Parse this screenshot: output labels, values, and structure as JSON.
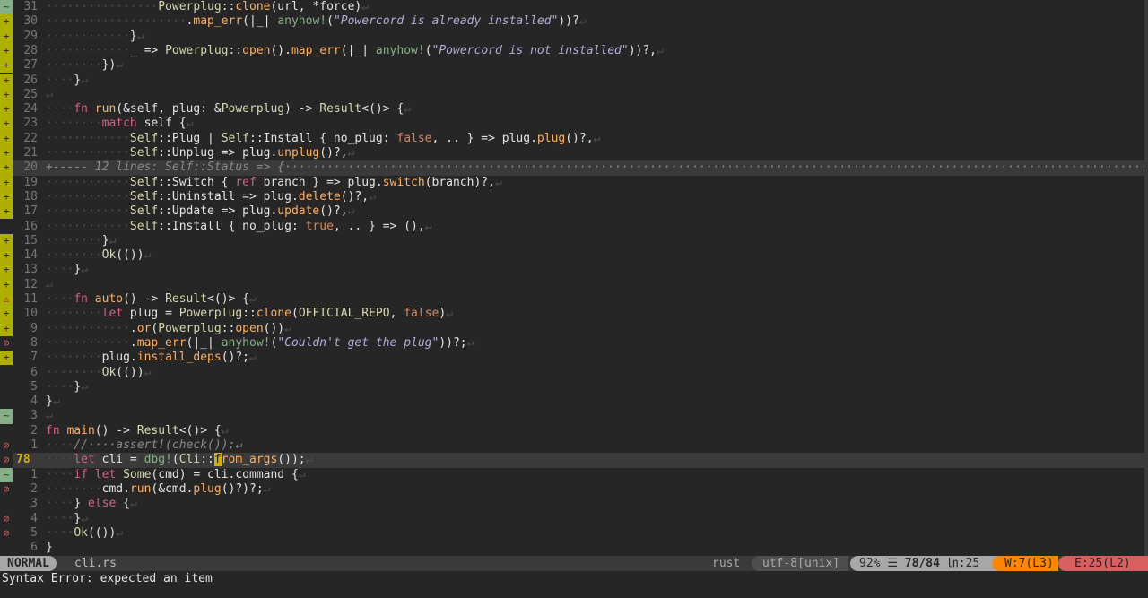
{
  "editor": {
    "lines": [
      {
        "sign": "chg",
        "num": "31",
        "text": "················Powerplug::clone(url, *force)↵"
      },
      {
        "sign": "add",
        "num": "30",
        "text": "····················.map_err(|_| anyhow!(\"Powercord is already installed\"))?↵"
      },
      {
        "sign": "add",
        "num": "29",
        "text": "············}↵"
      },
      {
        "sign": "add",
        "num": "28",
        "text": "············_ => Powerplug::open().map_err(|_| anyhow!(\"Powercord is not installed\"))?,↵"
      },
      {
        "sign": "add",
        "num": "27",
        "text": "········})↵"
      },
      {
        "sign": "add",
        "num": "26",
        "text": "····}↵"
      },
      {
        "sign": "add",
        "num": "25",
        "text": "↵"
      },
      {
        "sign": "add",
        "num": "24",
        "text": "····fn run(&self, plug: &Powerplug) -> Result<()> {↵"
      },
      {
        "sign": "add",
        "num": "23",
        "text": "········match self {↵"
      },
      {
        "sign": "add",
        "num": "22",
        "text": "············Self::Plug | Self::Install { no_plug: false, .. } => plug.plug()?,↵"
      },
      {
        "sign": "add",
        "num": "21",
        "text": "············Self::Unplug => plug.unplug()?,↵"
      },
      {
        "sign": "add",
        "num": "20",
        "text": "+----- 12 lines: Self::Status => {··········································································································································",
        "fold": true
      },
      {
        "sign": "add",
        "num": "19",
        "text": "············Self::Switch { ref branch } => plug.switch(branch)?,↵"
      },
      {
        "sign": "add",
        "num": "18",
        "text": "············Self::Uninstall => plug.delete()?,↵"
      },
      {
        "sign": "add",
        "num": "17",
        "text": "············Self::Update => plug.update()?,↵"
      },
      {
        "sign": "none",
        "num": "16",
        "text": "············Self::Install { no_plug: true, .. } => (),↵"
      },
      {
        "sign": "add",
        "num": "15",
        "text": "········}↵"
      },
      {
        "sign": "add",
        "num": "14",
        "text": "········Ok(())↵"
      },
      {
        "sign": "add",
        "num": "13",
        "text": "····}↵"
      },
      {
        "sign": "add",
        "num": "12",
        "text": "↵"
      },
      {
        "sign": "warn",
        "num": "11",
        "text": "····fn auto() -> Result<()> {↵"
      },
      {
        "sign": "add",
        "num": "10",
        "text": "········let plug = Powerplug::clone(OFFICIAL_REPO, false)↵"
      },
      {
        "sign": "add",
        "num": "9",
        "text": "············.or(Powerplug::open())↵"
      },
      {
        "sign": "err",
        "num": "8",
        "text": "············.map_err(|_| anyhow!(\"Couldn't get the plug\"))?;↵"
      },
      {
        "sign": "add",
        "num": "7",
        "text": "········plug.install_deps()?;↵"
      },
      {
        "sign": "none",
        "num": "6",
        "text": "········Ok(())↵"
      },
      {
        "sign": "none",
        "num": "5",
        "text": "····}↵"
      },
      {
        "sign": "none",
        "num": "4",
        "text": "}↵"
      },
      {
        "sign": "chg",
        "num": "3",
        "text": "↵"
      },
      {
        "sign": "none",
        "num": "2",
        "text": "fn main() -> Result<()> {↵"
      },
      {
        "sign": "err",
        "num": "1",
        "text": "····//····assert!(check());↵"
      },
      {
        "sign": "err",
        "num": "78",
        "text": "····let cli = dbg!(Cli::from_args());↵",
        "current": true
      },
      {
        "sign": "chg",
        "num": "1",
        "text": "····if let Some(cmd) = cli.command {↵"
      },
      {
        "sign": "err",
        "num": "2",
        "text": "········cmd.run(&cmd.plug()?)?;↵"
      },
      {
        "sign": "none",
        "num": "3",
        "text": "····} else {↵"
      },
      {
        "sign": "err",
        "num": "4",
        "text": "····}↵"
      },
      {
        "sign": "err",
        "num": "5",
        "text": "····Ok(())↵"
      },
      {
        "sign": "none",
        "num": "6",
        "text": "}"
      }
    ]
  },
  "statusline": {
    "mode": "NORMAL",
    "filename": "cli.rs",
    "filetype": "rust",
    "encoding": "utf-8[unix]",
    "percent": "92%",
    "position": "78/84",
    "column": ":25",
    "warnings": "W:7(L3)",
    "errors": "E:25(L2)"
  },
  "cmdline": "Syntax Error: expected an item",
  "colors": {
    "background": "#262626",
    "added_sign": "#afaf00",
    "changed_sign": "#87af87",
    "error": "#d75f5f",
    "warning": "#ff8700"
  }
}
